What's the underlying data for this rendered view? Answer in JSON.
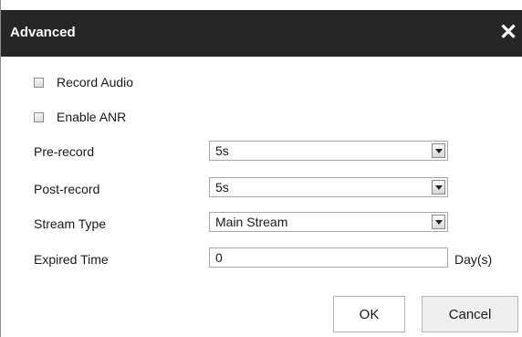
{
  "dialog": {
    "title": "Advanced",
    "close_icon": "close-icon"
  },
  "options": {
    "record_audio": {
      "label": "Record Audio",
      "checked": false
    },
    "enable_anr": {
      "label": "Enable ANR",
      "checked": false
    }
  },
  "fields": {
    "pre_record": {
      "label": "Pre-record",
      "value": "5s"
    },
    "post_record": {
      "label": "Post-record",
      "value": "5s"
    },
    "stream_type": {
      "label": "Stream Type",
      "value": "Main Stream"
    },
    "expired_time": {
      "label": "Expired Time",
      "value": "0",
      "unit": "Day(s)"
    }
  },
  "buttons": {
    "ok": "OK",
    "cancel": "Cancel"
  }
}
